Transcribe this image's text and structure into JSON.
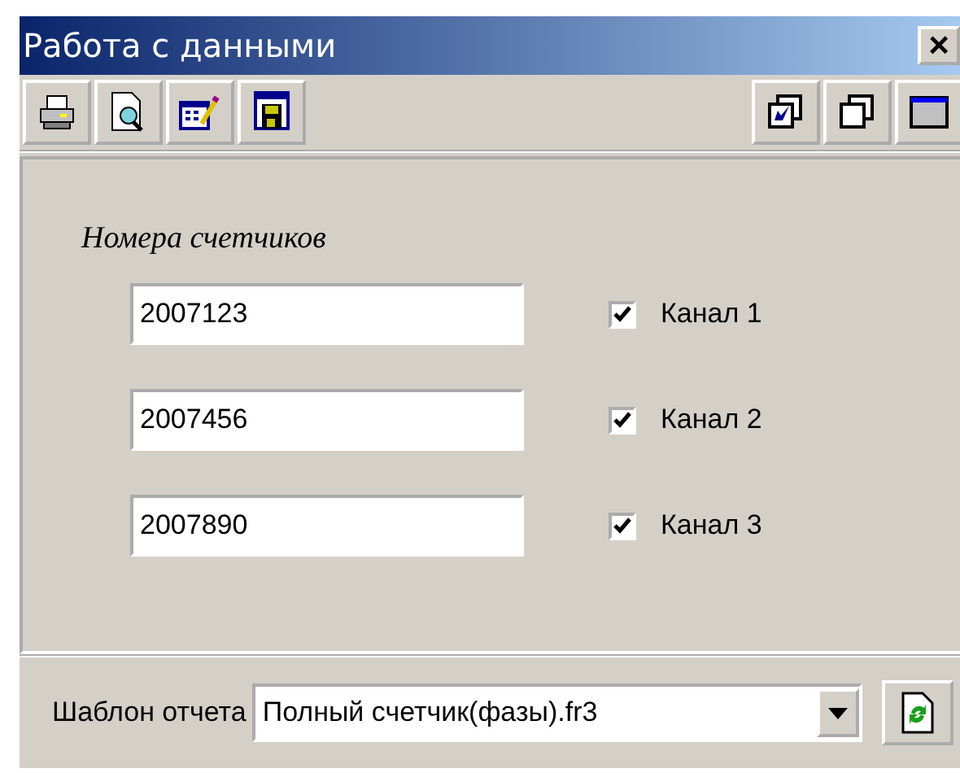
{
  "window": {
    "title": "Работа с данными",
    "close": "×"
  },
  "section_label": "Номера счетчиков",
  "meters": [
    {
      "number": "2007123",
      "channel": "Канал 1",
      "checked": true
    },
    {
      "number": "2007456",
      "channel": "Канал 2",
      "checked": true
    },
    {
      "number": "2007890",
      "channel": "Канал 3",
      "checked": true
    }
  ],
  "template": {
    "label": "Шаблон отчета",
    "value": "Полный счетчик(фазы).fr3"
  }
}
